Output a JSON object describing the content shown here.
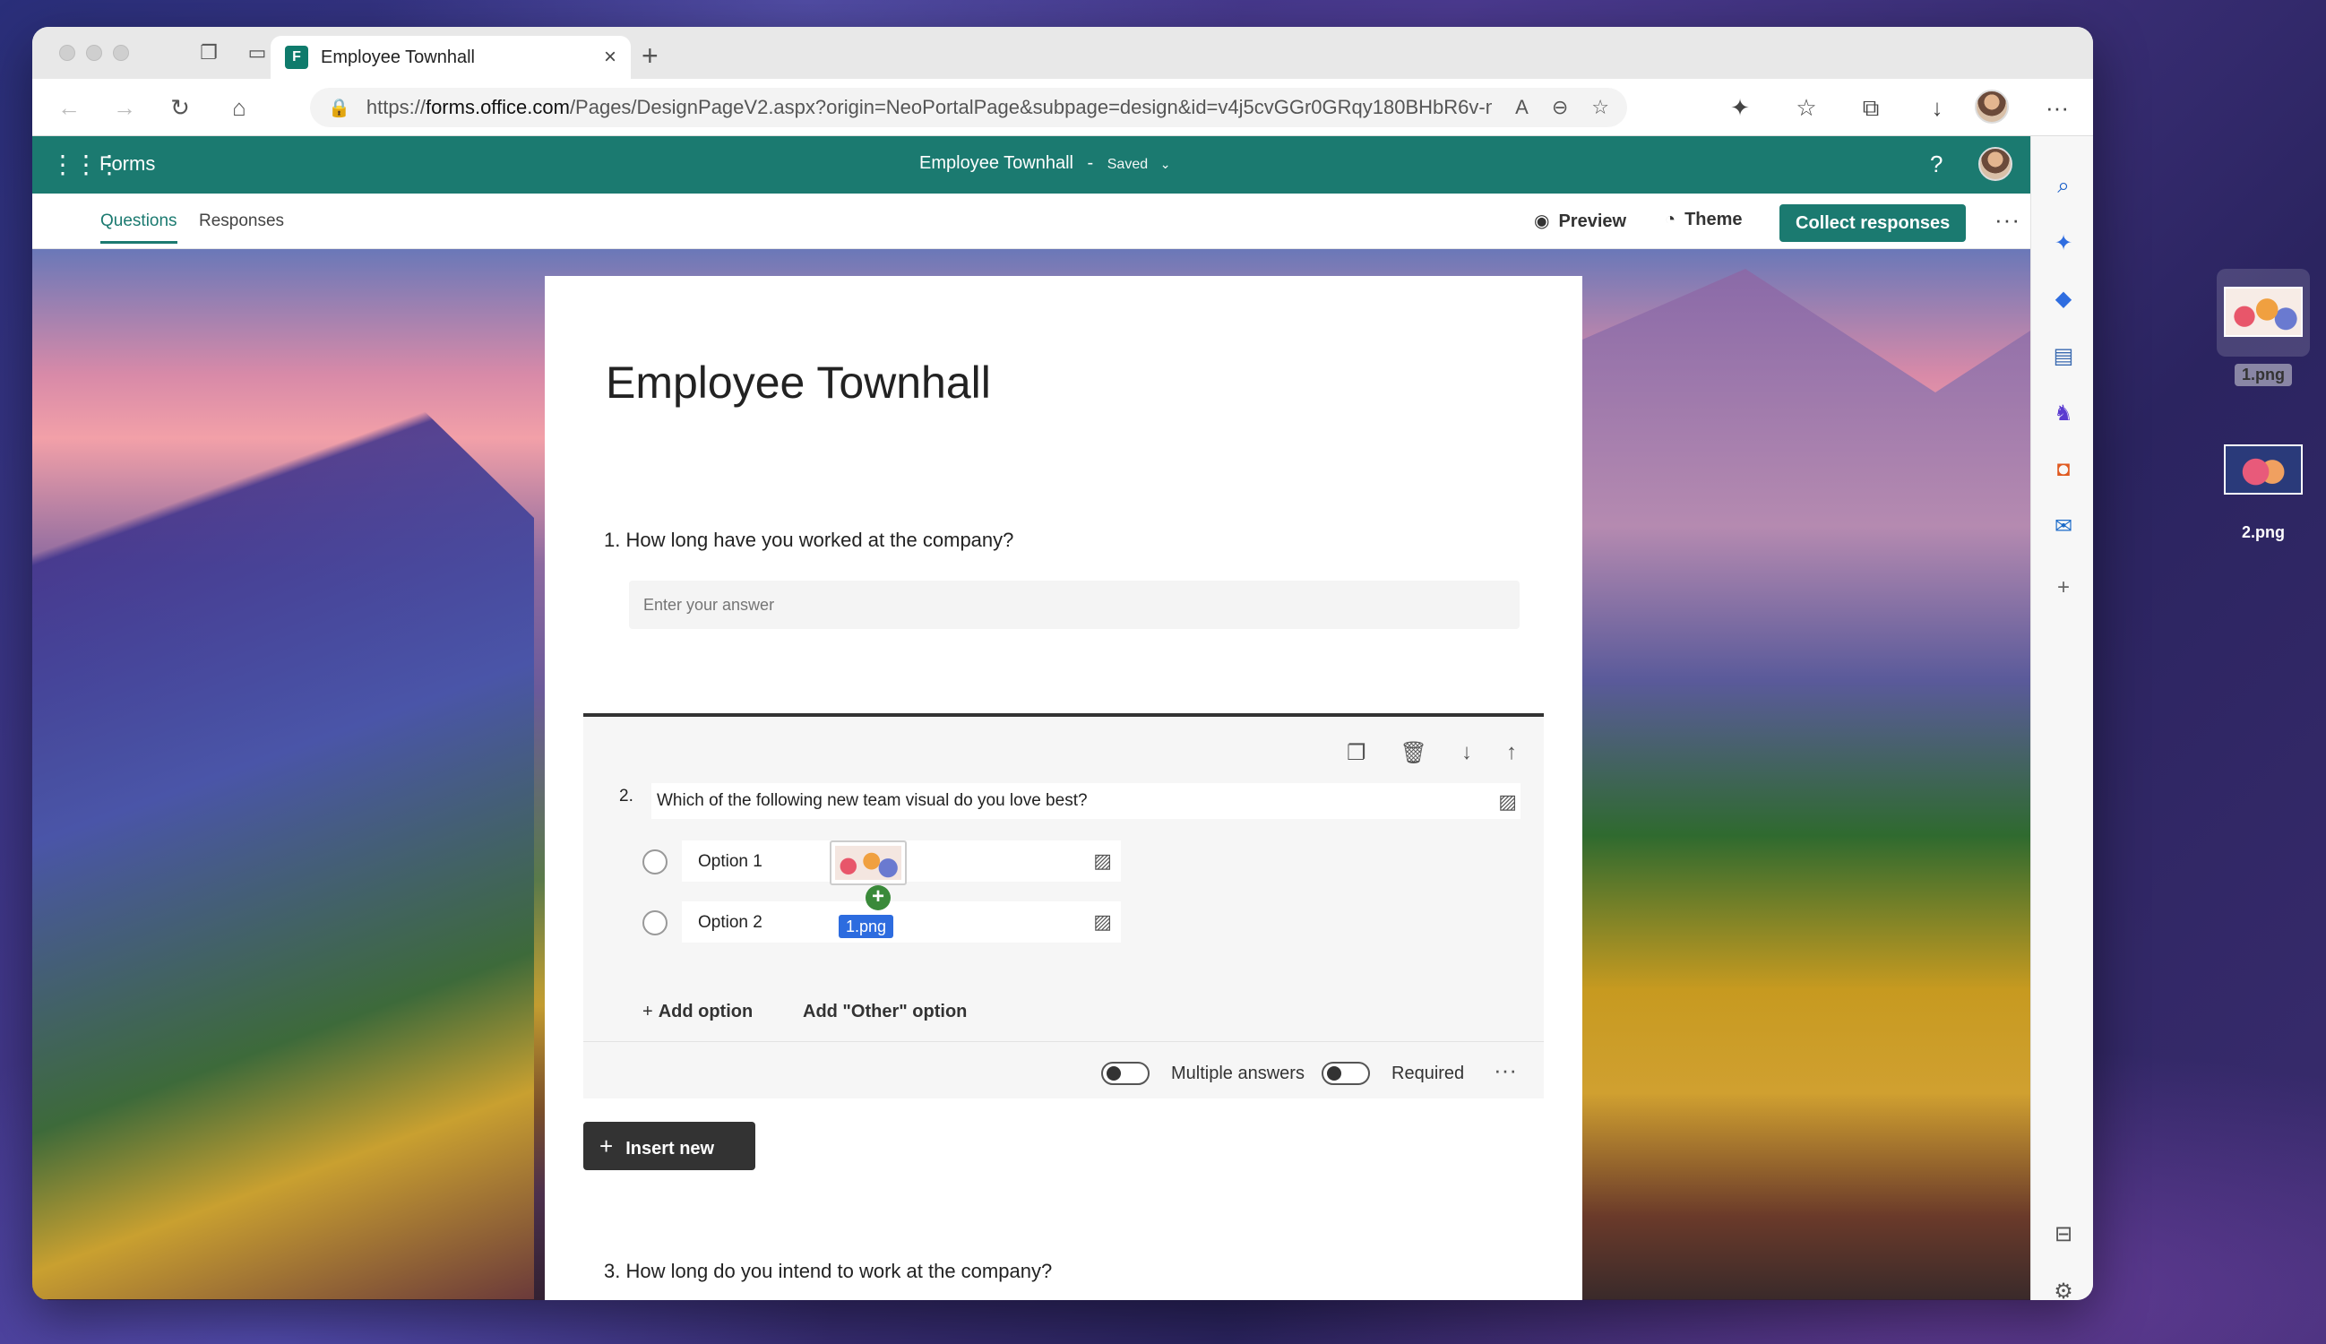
{
  "browser": {
    "tab_title": "Employee Townhall",
    "tab_close": "×",
    "new_tab": "+",
    "url_prefix": "https://",
    "url_domain": "forms.office.com",
    "url_rest": "/Pages/DesignPageV2.aspx?origin=NeoPortalPage&subpage=design&id=v4j5cvGGr0GRqy180BHbR6v-mIbZ..."
  },
  "forms_bar": {
    "app_name": "Forms",
    "doc_title": "Employee Townhall",
    "separator": "-",
    "saved": "Saved",
    "help": "?"
  },
  "command_bar": {
    "tabs": [
      {
        "label": "Questions",
        "active": true
      },
      {
        "label": "Responses",
        "active": false
      }
    ],
    "preview": "Preview",
    "theme": "Theme",
    "collect": "Collect responses",
    "more": "···"
  },
  "form": {
    "title": "Employee Townhall",
    "q1": {
      "label": "1. How long have you worked at the company?",
      "placeholder": "Enter your answer"
    },
    "q2": {
      "number": "2.",
      "text": "Which of the following new team visual do you love best?",
      "options": [
        {
          "label": "Option 1"
        },
        {
          "label": "Option 2"
        }
      ],
      "add_option": "Add option",
      "add_other": "Add \"Other\" option",
      "multiple_answers": "Multiple answers",
      "required": "Required",
      "more": "···"
    },
    "insert_new": "Insert new",
    "q3": {
      "label": "3. How long do you intend to work at the company?"
    }
  },
  "drag": {
    "file_label": "1.png",
    "plus": "+"
  },
  "desktop_files": [
    {
      "name": "1.png",
      "selected": true
    },
    {
      "name": "2.png",
      "selected": false
    }
  ],
  "colors": {
    "forms_teal": "#1b7a70",
    "drag_label_blue": "#2d6cdf"
  }
}
